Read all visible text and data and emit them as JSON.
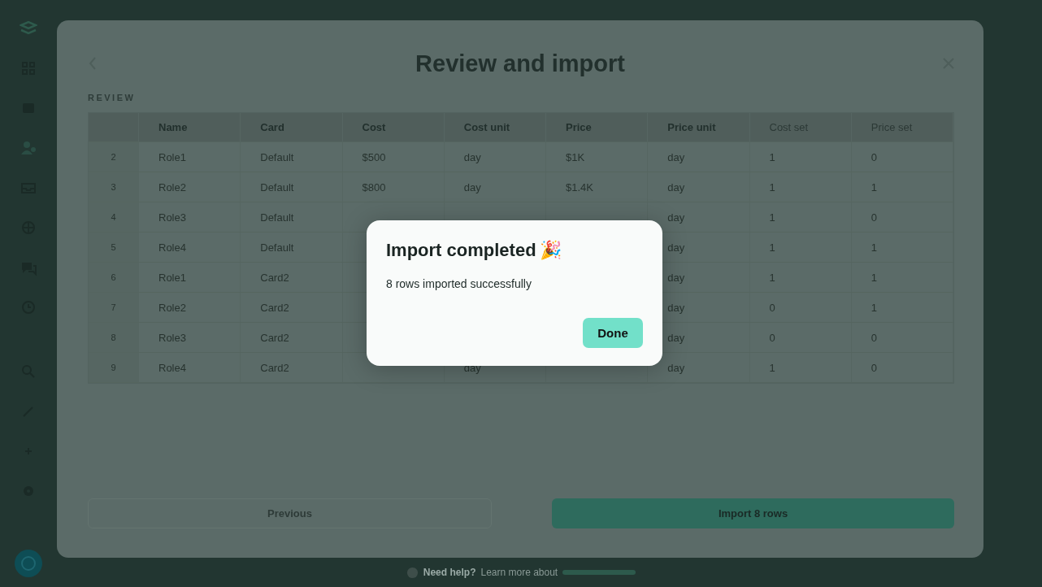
{
  "sidebar": {
    "items": [
      {
        "kind": "logo"
      },
      {
        "kind": "grid"
      },
      {
        "kind": "calendar"
      },
      {
        "kind": "people"
      },
      {
        "kind": "inbox"
      },
      {
        "kind": "globe"
      },
      {
        "kind": "chat"
      },
      {
        "kind": "clock"
      },
      {
        "kind": "search"
      },
      {
        "kind": "pencil"
      },
      {
        "kind": "plus"
      },
      {
        "kind": "gear"
      },
      {
        "kind": "avatar"
      }
    ]
  },
  "modal": {
    "title": "Review and import",
    "section_label": "REVIEW",
    "table": {
      "columns": [
        {
          "label": "Name",
          "required": true
        },
        {
          "label": "Card",
          "required": true
        },
        {
          "label": "Cost",
          "required": true
        },
        {
          "label": "Cost unit",
          "required": true
        },
        {
          "label": "Price",
          "required": true
        },
        {
          "label": "Price unit",
          "required": true
        },
        {
          "label": "Cost set",
          "required": false
        },
        {
          "label": "Price set",
          "required": false
        }
      ],
      "rows": [
        {
          "num": "2",
          "name": "Role1",
          "card": "Default",
          "cost": "$500",
          "cost_unit": "day",
          "price": "$1K",
          "price_unit": "day",
          "cost_set": "1",
          "price_set": "0"
        },
        {
          "num": "3",
          "name": "Role2",
          "card": "Default",
          "cost": "$800",
          "cost_unit": "day",
          "price": "$1.4K",
          "price_unit": "day",
          "cost_set": "1",
          "price_set": "1"
        },
        {
          "num": "4",
          "name": "Role3",
          "card": "Default",
          "price_unit": "day",
          "cost_set": "1",
          "price_set": "0"
        },
        {
          "num": "5",
          "name": "Role4",
          "card": "Default",
          "price_unit": "day",
          "cost_set": "1",
          "price_set": "1"
        },
        {
          "num": "6",
          "name": "Role1",
          "card": "Card2",
          "price_unit": "day",
          "cost_set": "1",
          "price_set": "1"
        },
        {
          "num": "7",
          "name": "Role2",
          "card": "Card2",
          "price_unit": "day",
          "cost_set": "0",
          "price_set": "1"
        },
        {
          "num": "8",
          "name": "Role3",
          "card": "Card2",
          "price_unit": "day",
          "cost_set": "0",
          "price_set": "0"
        },
        {
          "num": "9",
          "name": "Role4",
          "card": "Card2",
          "cost_unit": "day",
          "price_unit": "day",
          "cost_set": "1",
          "price_set": "0"
        }
      ]
    },
    "buttons": [
      {
        "label": "Previous",
        "kind": "secondary",
        "disabled": true
      },
      {
        "label": "Import 8 rows",
        "kind": "primary",
        "disabled": false
      }
    ]
  },
  "footer": {
    "question": "Need help?",
    "text": "Learn more about"
  },
  "dialog": {
    "title": "Import completed",
    "emoji": "🎉",
    "message": "8 rows imported successfully",
    "button": "Done"
  }
}
